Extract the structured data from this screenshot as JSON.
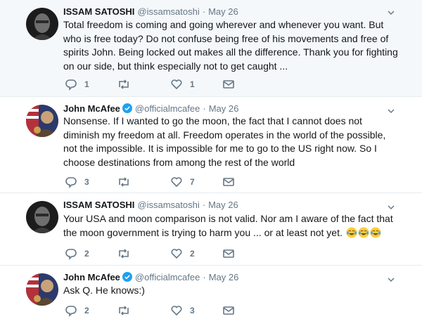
{
  "tweets": [
    {
      "name": "ISSAM SATOSHI",
      "handle": "@issamsatoshi",
      "separator": "·",
      "time": "May 26",
      "verified": false,
      "text": "Total freedom is coming and going wherever and whenever you want. But who is free today? Do not confuse being free of his movements and free of spirits John. Being locked out makes all the difference. Thank you for fighting on our side, but think especially not to get caught ...",
      "replies": "1",
      "retweets": "",
      "likes": "1"
    },
    {
      "name": "John McAfee",
      "handle": "@officialmcafee",
      "separator": "·",
      "time": "May 26",
      "verified": true,
      "text": "Nonsense. If I wanted to go the moon, the fact that I cannot does not diminish my freedom at all. Freedom operates in the world of the possible, not the impossible. It is impossible for me to go to the US right now. So I choose destinations from among the rest of the world",
      "replies": "3",
      "retweets": "",
      "likes": "7"
    },
    {
      "name": "ISSAM SATOSHI",
      "handle": "@issamsatoshi",
      "separator": "·",
      "time": "May 26",
      "verified": false,
      "text": "Your USA and moon comparison is not valid. Nor am I aware of the fact that the moon government is trying to harm you ... or at least not yet.",
      "emoji_count": 3,
      "emoji_name": "face-with-tears-of-joy-icon",
      "replies": "2",
      "retweets": "",
      "likes": "2"
    },
    {
      "name": "John McAfee",
      "handle": "@officialmcafee",
      "separator": "·",
      "time": "May 26",
      "verified": true,
      "text": "Ask Q. He knows:)",
      "replies": "2",
      "retweets": "",
      "likes": "3"
    }
  ],
  "colors": {
    "name": "#14171a",
    "meta": "#657786",
    "verified": "#1da1f2",
    "highlight_bg": "#f5f8fa",
    "border": "#e6ecf0"
  }
}
